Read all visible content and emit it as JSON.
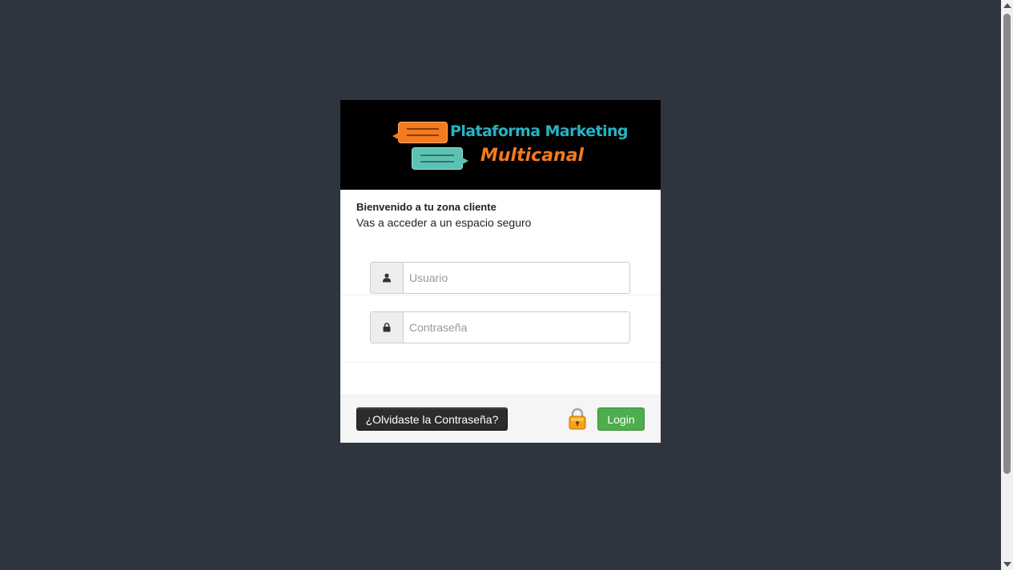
{
  "brand": {
    "title": "Plataforma Marketing",
    "subtitle": "Multicanal",
    "colors": {
      "teal": "#26b3c4",
      "orange": "#f47a1f"
    }
  },
  "welcome": {
    "title": "Bienvenido a tu zona cliente",
    "subtitle": "Vas a acceder a un espacio seguro"
  },
  "form": {
    "username": {
      "placeholder": "Usuario",
      "value": "",
      "icon": "user-icon"
    },
    "password": {
      "placeholder": "Contraseña",
      "value": "",
      "icon": "lock-icon"
    }
  },
  "footer": {
    "forgot_label": "¿Olvidaste la Contraseña?",
    "login_label": "Login",
    "secure_icon": "padlock-icon"
  }
}
